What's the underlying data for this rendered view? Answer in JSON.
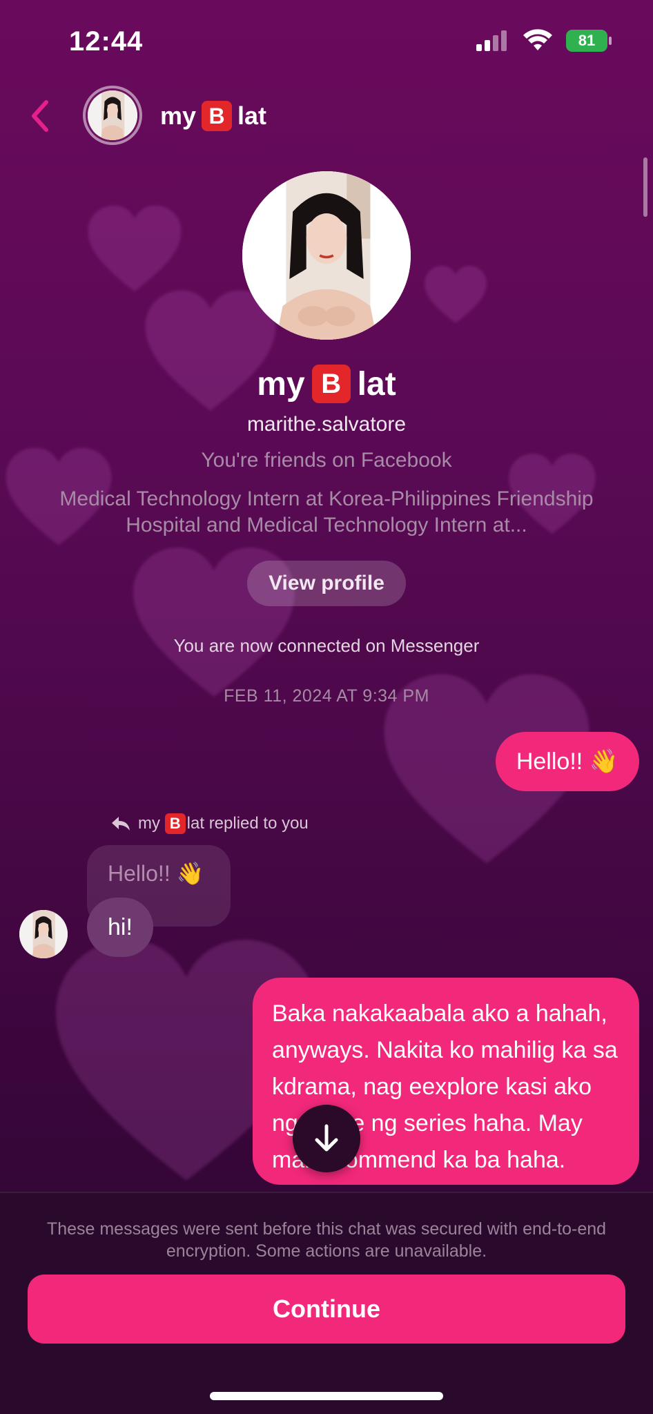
{
  "status_bar": {
    "time": "12:44",
    "battery": "81",
    "icons": [
      "cellular-signal-icon",
      "wifi-icon",
      "battery-charging-icon"
    ]
  },
  "header": {
    "name_prefix": "my",
    "name_emoji": "B",
    "name_suffix": "lat",
    "back_icon": "chevron-left-icon"
  },
  "profile": {
    "name_prefix": "my",
    "name_emoji": "B",
    "name_suffix": "lat",
    "username": "marithe.salvatore",
    "friends_text": "You're friends on Facebook",
    "work_text": "Medical Technology Intern at Korea-Philippines Friendship Hospital and Medical Technology Intern at...",
    "view_profile_label": "View profile",
    "connected_text": "You are now connected on Messenger"
  },
  "messages": {
    "timestamp": "FEB 11, 2024 AT 9:34 PM",
    "outgoing_hello": "Hello!! 👋",
    "reply_note_prefix": "my",
    "reply_note_emoji": "B",
    "reply_note_suffix": "lat replied to you",
    "quoted_text": "Hello!! 👋",
    "incoming_reply": "hi!",
    "outgoing_long": "Baka nakakaabala ako a hahah, anyways. Nakita ko mahilig ka sa kdrama, nag eexplore kasi ako ng genre ng series haha. May marrecommend ka ba haha."
  },
  "footer": {
    "encryption_note": "These messages were sent before this chat was secured with end-to-end encryption. Some actions are unavailable.",
    "continue_label": "Continue"
  },
  "colors": {
    "accent": "#f2287a",
    "background_top": "#6a0a5c",
    "background_bottom": "#2a0730",
    "incoming_bubble": "#6e3a6f",
    "emoji_red": "#e2262a"
  }
}
